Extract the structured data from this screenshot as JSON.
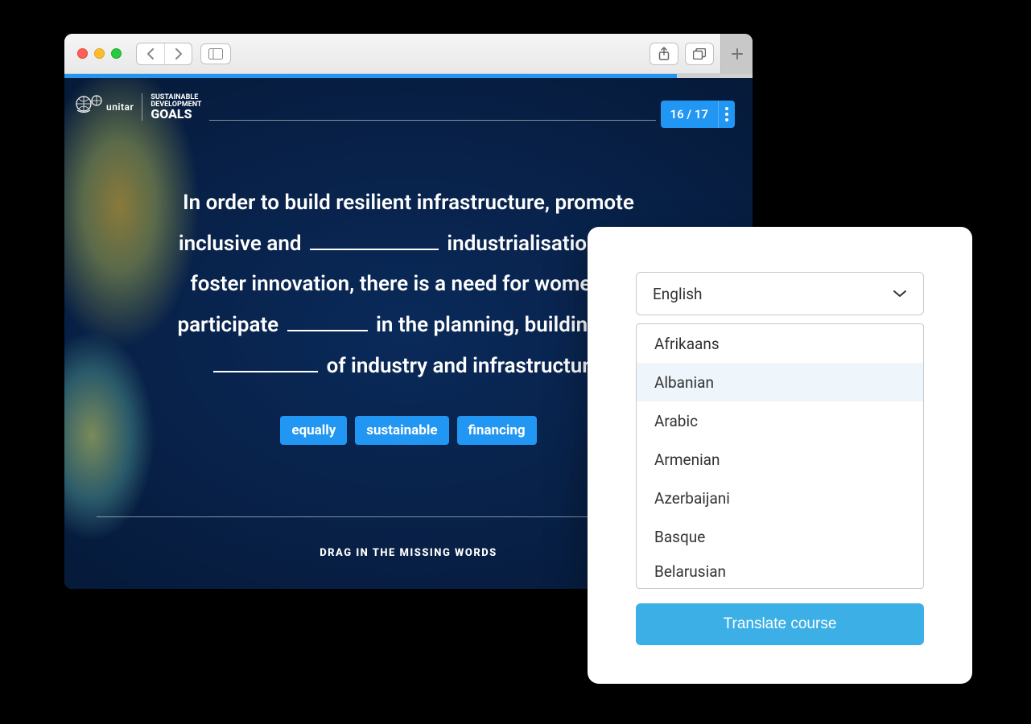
{
  "logo": {
    "org": "unitar",
    "line1": "SUSTAINABLE",
    "line2": "DEVELOPMENT",
    "line3": "GOALS"
  },
  "counter": "16 / 17",
  "question": {
    "line1_a": "In order to build resilient infrastructure, promote",
    "line2_a": "inclusive and",
    "line2_b": "industrialisation and",
    "line3_a": "foster innovation, there is a need for women to",
    "line4_a": "participate",
    "line4_b": "in the planning, building and",
    "line5_b": "of industry and infrastructure."
  },
  "chips": [
    "equally",
    "sustainable",
    "financing"
  ],
  "instruction": "DRAG IN THE MISSING WORDS",
  "translate": {
    "selected": "English",
    "options": [
      "Afrikaans",
      "Albanian",
      "Arabic",
      "Armenian",
      "Azerbaijani",
      "Basque",
      "Belarusian"
    ],
    "hover_index": 1,
    "button": "Translate course"
  }
}
